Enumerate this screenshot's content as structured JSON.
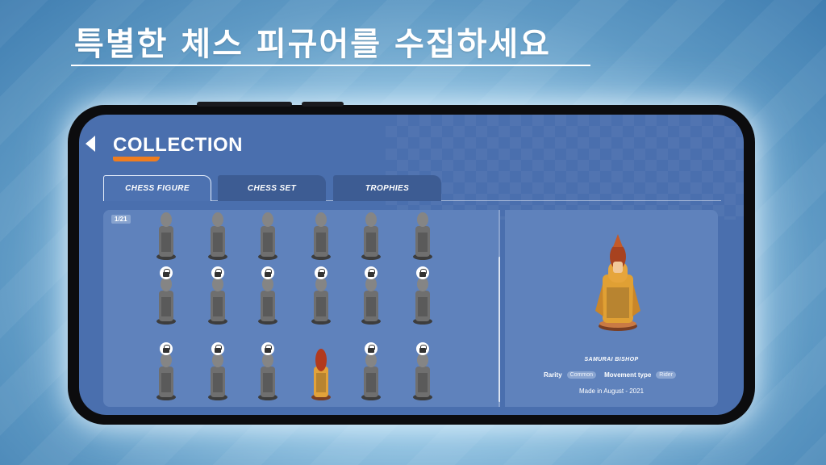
{
  "headline": "특별한 체스 피규어를 수집하세요",
  "screen": {
    "title": "COLLECTION",
    "tabs": [
      {
        "label": "CHESS FIGURE",
        "active": true
      },
      {
        "label": "CHESS SET",
        "active": false
      },
      {
        "label": "TROPHIES",
        "active": false
      }
    ],
    "page_indicator": "1/21",
    "figures": [
      {
        "icon": "chess-figure-icon",
        "locked": false,
        "unlocked_color": "#8a8a8a"
      },
      {
        "icon": "chess-figure-icon",
        "locked": false
      },
      {
        "icon": "chess-figure-icon",
        "locked": false
      },
      {
        "icon": "chess-figure-icon",
        "locked": false
      },
      {
        "icon": "chess-figure-icon",
        "locked": false
      },
      {
        "icon": "chess-figure-icon",
        "locked": false
      },
      {
        "icon": "chess-figure-icon",
        "locked": true
      },
      {
        "icon": "chess-figure-icon",
        "locked": true
      },
      {
        "icon": "chess-figure-icon",
        "locked": true
      },
      {
        "icon": "chess-figure-icon",
        "locked": true
      },
      {
        "icon": "chess-figure-icon",
        "locked": true
      },
      {
        "icon": "chess-figure-icon",
        "locked": true
      },
      {
        "icon": "chess-figure-icon",
        "locked": true
      },
      {
        "icon": "chess-figure-icon",
        "locked": true
      },
      {
        "icon": "chess-figure-icon",
        "locked": true
      },
      {
        "icon": "chess-figure-icon",
        "locked": false,
        "selected": true
      },
      {
        "icon": "chess-figure-icon",
        "locked": true
      },
      {
        "icon": "chess-figure-icon",
        "locked": true
      }
    ],
    "detail": {
      "name": "SAMURAI BISHOP",
      "rarity_label": "Rarity",
      "rarity_value": "Common",
      "movement_label": "Movement type",
      "movement_value": "Rider",
      "made": "Made in August - 2021"
    }
  },
  "colors": {
    "accent": "#ef7d1f",
    "figure_gray": "#6f6f6f",
    "figure_gold": "#e2a23a",
    "figure_red": "#b23a1e"
  }
}
